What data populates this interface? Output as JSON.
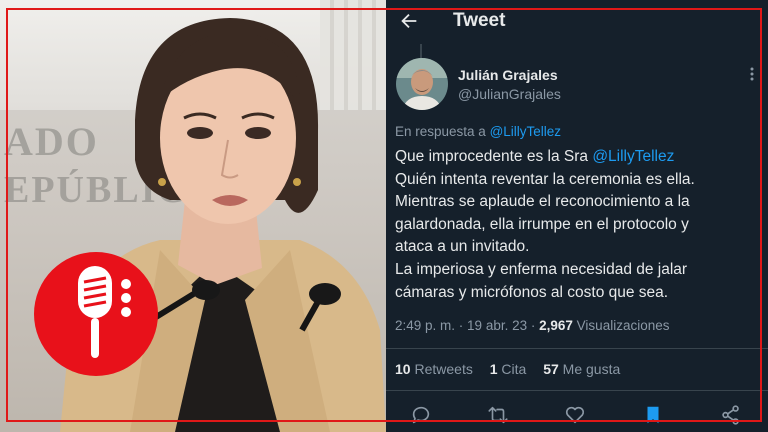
{
  "colors": {
    "panel_bg": "#15202b",
    "text": "#e7e9ea",
    "muted": "#8b98a5",
    "link": "#1d9bf0",
    "frame_red": "#e01818",
    "logo_red": "#e8111a"
  },
  "photo": {
    "wall_text_line1": "ADO",
    "wall_text_line2": "EPÚBLICA"
  },
  "header": {
    "title": "Tweet",
    "back_icon": "arrow-left-icon"
  },
  "tweet": {
    "author_name": "Julián Grajales",
    "author_handle": "@JulianGrajales",
    "reply_prefix": "En respuesta a",
    "reply_handle": "@LillyTellez",
    "body": {
      "line1_text": "Que improcedente es la Sra",
      "line1_mention": "@LillyTellez",
      "line2": "Quién intenta reventar la ceremonia es ella.",
      "line3": "Mientras se aplaude el reconocimiento a la",
      "line4": "galardonada, ella irrumpe en el protocolo y",
      "line5": "ataca a un invitado.",
      "line6": "La imperiosa y enferma necesidad de jalar",
      "line7": "cámaras y micrófonos al costo que sea."
    },
    "time": "2:49 p. m.",
    "date": "19 abr. 23",
    "views_count": "2,967",
    "views_label": "Visualizaciones"
  },
  "stats": {
    "retweets_count": "10",
    "retweets_label": "Retweets",
    "quotes_count": "1",
    "quotes_label": "Cita",
    "likes_count": "57",
    "likes_label": "Me gusta"
  },
  "actions": [
    "reply-icon",
    "retweet-icon",
    "like-heart-icon",
    "bookmark-icon",
    "share-icon"
  ]
}
